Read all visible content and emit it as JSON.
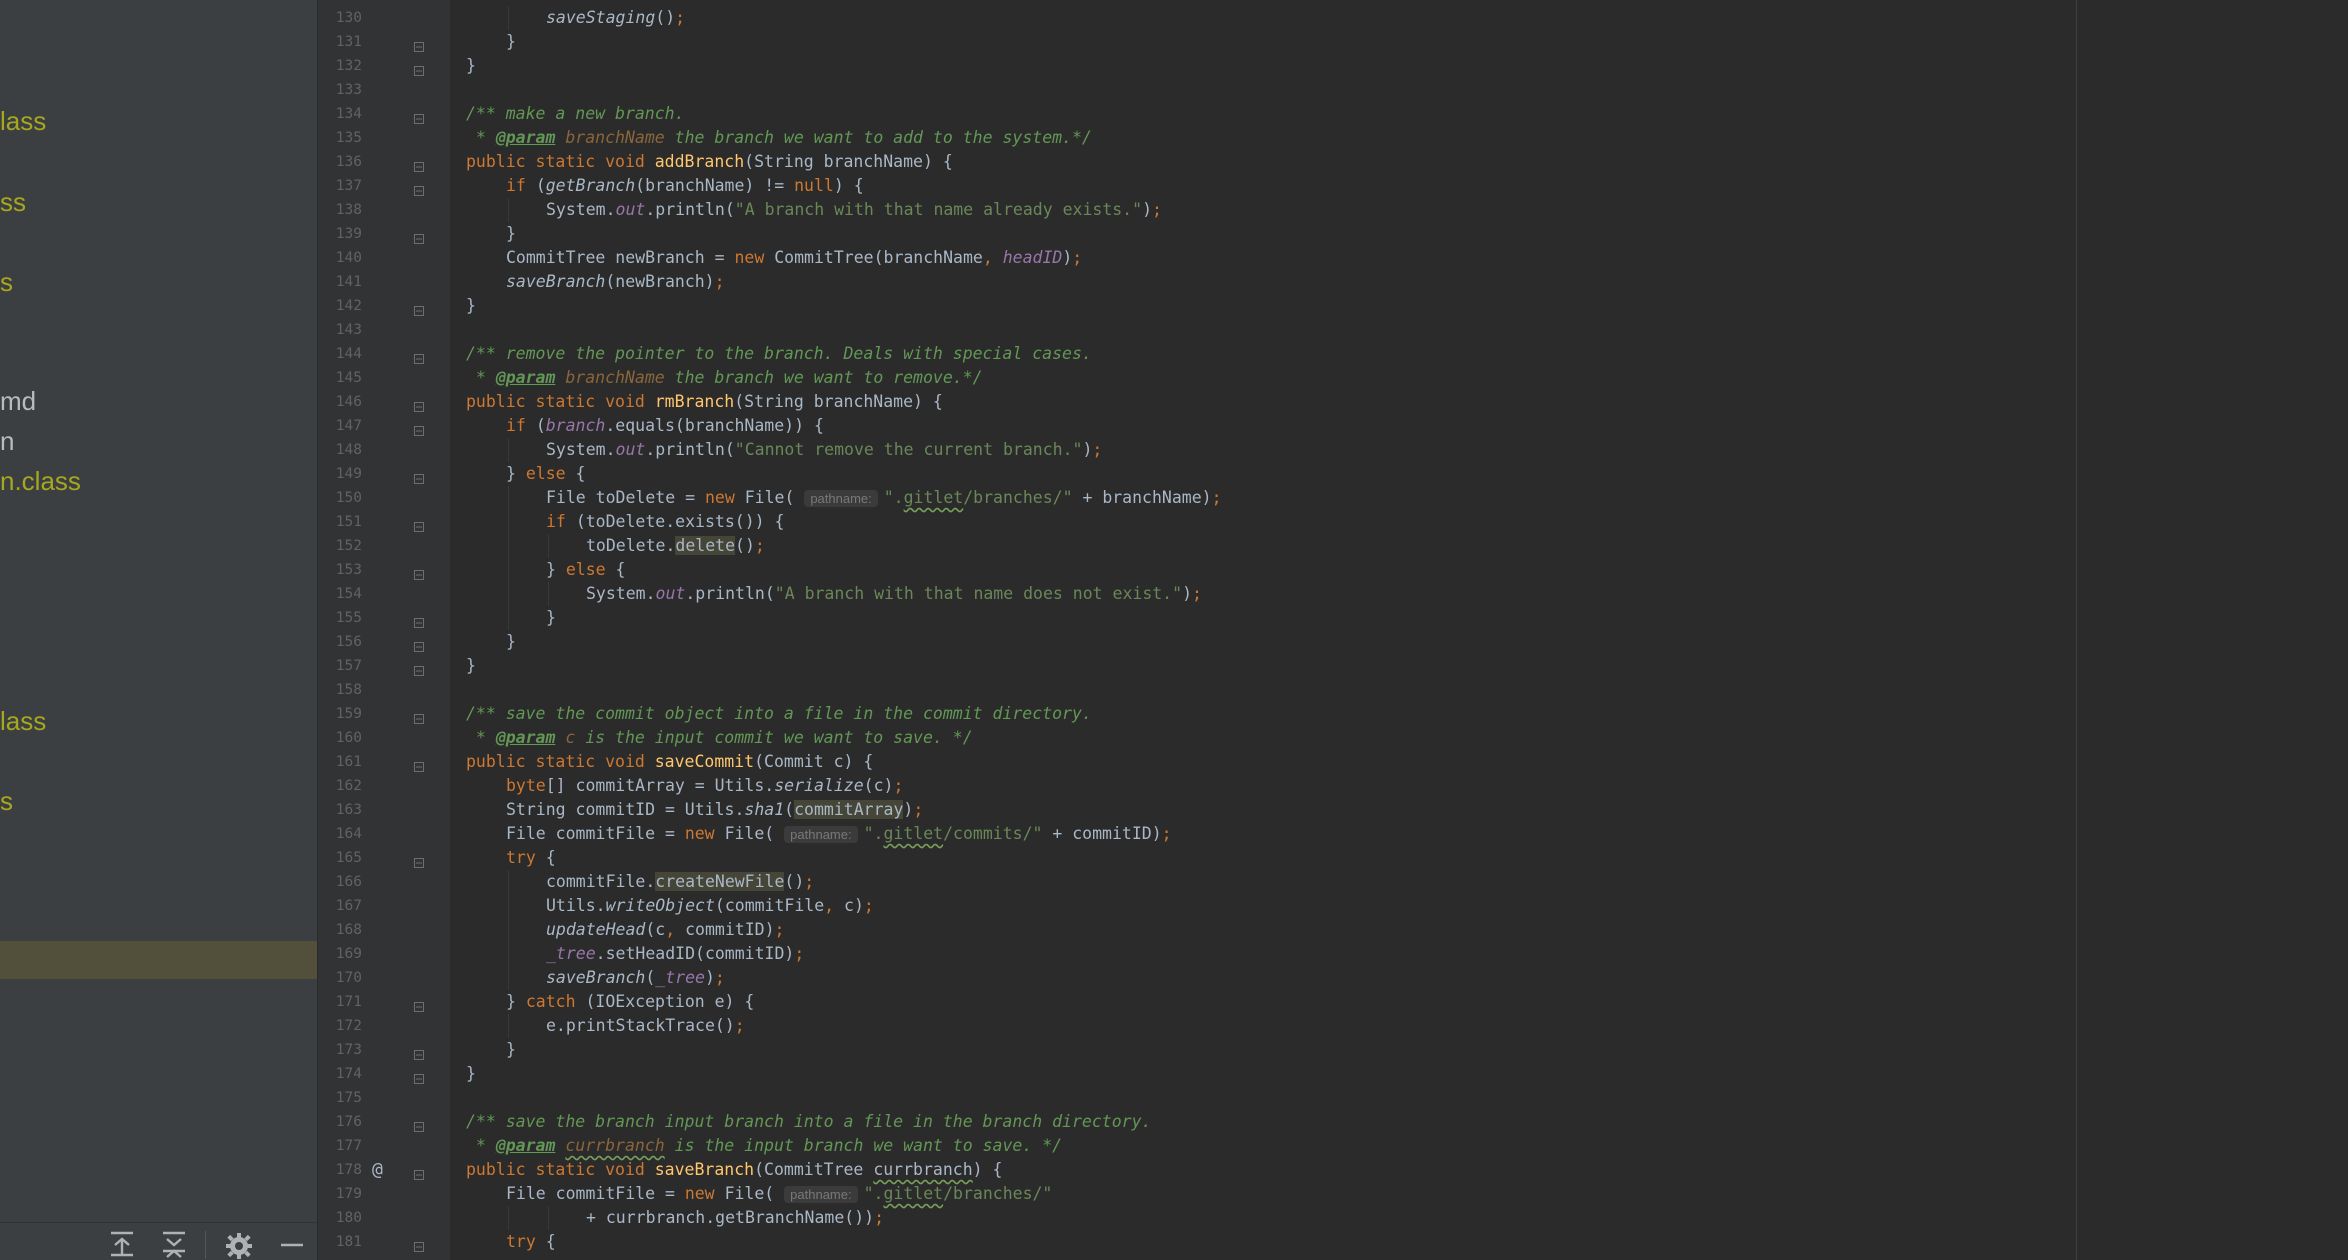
{
  "sidebar": {
    "items": [
      {
        "label": "lass",
        "style": "ignored"
      },
      {
        "label": "ss",
        "style": "ignored"
      },
      {
        "label": "s",
        "style": "ignored"
      },
      {
        "label": "md",
        "style": "plain"
      },
      {
        "label": "n",
        "style": "plain"
      },
      {
        "label": "n.class",
        "style": "ignored"
      },
      {
        "label": "lass",
        "style": "ignored"
      },
      {
        "label": "s",
        "style": "ignored"
      }
    ]
  },
  "editor": {
    "lines": [
      {
        "n": "130",
        "indent": 2,
        "html": "<span class=\"st\">saveStaging</span>()<span class=\"kw\">;</span>"
      },
      {
        "n": "131",
        "indent": 1,
        "html": "}"
      },
      {
        "n": "132",
        "indent": 0,
        "html": "}"
      },
      {
        "n": "133",
        "indent": 0,
        "html": ""
      },
      {
        "n": "134",
        "indent": 0,
        "html": "<span class=\"cm\">/** make a new branch.</span>"
      },
      {
        "n": "135",
        "indent": 0,
        "html": "<span class=\"cm\"> * </span><span class=\"tag\">@param</span><span class=\"cm\"> </span><span class=\"pn\">branchName</span><span class=\"cm\"> the branch we want to add to the system.*/</span>"
      },
      {
        "n": "136",
        "indent": 0,
        "html": "<span class=\"kw\">public static void </span><span class=\"fn\">addBranch</span>(String branchName) {"
      },
      {
        "n": "137",
        "indent": 1,
        "html": "<span class=\"kw\">if </span>(<span class=\"st\">getBranch</span>(branchName) != <span class=\"kw\">null</span>) {"
      },
      {
        "n": "138",
        "indent": 2,
        "html": "System.<span class=\"fld\">out</span>.println(<span class=\"str\">\"A branch with that name already exists.\"</span>)<span class=\"kw\">;</span>"
      },
      {
        "n": "139",
        "indent": 1,
        "html": "}"
      },
      {
        "n": "140",
        "indent": 1,
        "html": "CommitTree newBranch = <span class=\"kw\">new </span>CommitTree(branchName<span class=\"kw\">, </span><span class=\"fld\">headID</span>)<span class=\"kw\">;</span>"
      },
      {
        "n": "141",
        "indent": 1,
        "html": "<span class=\"st\">saveBranch</span>(newBranch)<span class=\"kw\">;</span>"
      },
      {
        "n": "142",
        "indent": 0,
        "html": "}"
      },
      {
        "n": "143",
        "indent": 0,
        "html": ""
      },
      {
        "n": "144",
        "indent": 0,
        "html": "<span class=\"cm\">/** remove the pointer to the branch. Deals with special cases.</span>"
      },
      {
        "n": "145",
        "indent": 0,
        "html": "<span class=\"cm\"> * </span><span class=\"tag\">@param</span><span class=\"cm\"> </span><span class=\"pn\">branchName</span><span class=\"cm\"> the branch we want to remove.*/</span>"
      },
      {
        "n": "146",
        "indent": 0,
        "html": "<span class=\"kw\">public static void </span><span class=\"fn\">rmBranch</span>(String branchName) {"
      },
      {
        "n": "147",
        "indent": 1,
        "html": "<span class=\"kw\">if </span>(<span class=\"fld\">branch</span>.equals(branchName)) {"
      },
      {
        "n": "148",
        "indent": 2,
        "html": "System.<span class=\"fld\">out</span>.println(<span class=\"str\">\"Cannot remove the current branch.\"</span>)<span class=\"kw\">;</span>"
      },
      {
        "n": "149",
        "indent": 1,
        "html": "} <span class=\"kw\">else </span>{"
      },
      {
        "n": "150",
        "indent": 2,
        "html": "File toDelete = <span class=\"kw\">new </span>File( <span class=\"hint\">pathname:</span><span class=\"str\">\".<span class=\"sq\">gitlet</span>/branches/\"</span> + branchName)<span class=\"kw\">;</span>"
      },
      {
        "n": "151",
        "indent": 2,
        "html": "<span class=\"kw\">if </span>(toDelete.exists()) {"
      },
      {
        "n": "152",
        "indent": 3,
        "html": "toDelete.<span class=\"hl\">delete</span>()<span class=\"kw\">;</span>"
      },
      {
        "n": "153",
        "indent": 2,
        "html": "} <span class=\"kw\">else </span>{"
      },
      {
        "n": "154",
        "indent": 3,
        "html": "System.<span class=\"fld\">out</span>.println(<span class=\"str\">\"A branch with that name does not exist.\"</span>)<span class=\"kw\">;</span>"
      },
      {
        "n": "155",
        "indent": 2,
        "html": "}"
      },
      {
        "n": "156",
        "indent": 1,
        "html": "}"
      },
      {
        "n": "157",
        "indent": 0,
        "html": "}"
      },
      {
        "n": "158",
        "indent": 0,
        "html": ""
      },
      {
        "n": "159",
        "indent": 0,
        "html": "<span class=\"cm\">/** save the commit object into a file in the commit directory.</span>"
      },
      {
        "n": "160",
        "indent": 0,
        "html": "<span class=\"cm\"> * </span><span class=\"tag\">@param</span><span class=\"cm\"> </span><span class=\"pn\">c</span><span class=\"cm\"> is the input commit we want to save. */</span>"
      },
      {
        "n": "161",
        "indent": 0,
        "html": "<span class=\"kw\">public static void </span><span class=\"fn\">saveCommit</span>(Commit c) {"
      },
      {
        "n": "162",
        "indent": 1,
        "html": "<span class=\"kw\">byte</span>[] commitArray = Utils.<span class=\"st\">serialize</span>(c)<span class=\"kw\">;</span>"
      },
      {
        "n": "163",
        "indent": 1,
        "html": "String commitID = Utils.<span class=\"st\">sha1</span>(<span class=\"hl\">commitArray</span>)<span class=\"kw\">;</span>"
      },
      {
        "n": "164",
        "indent": 1,
        "html": "File commitFile = <span class=\"kw\">new </span>File( <span class=\"hint\">pathname:</span><span class=\"str\">\".<span class=\"sq\">gitlet</span>/commits/\"</span> + commitID)<span class=\"kw\">;</span>"
      },
      {
        "n": "165",
        "indent": 1,
        "html": "<span class=\"kw\">try </span>{"
      },
      {
        "n": "166",
        "indent": 2,
        "html": "commitFile.<span class=\"hl\">createNewFile</span>()<span class=\"kw\">;</span>"
      },
      {
        "n": "167",
        "indent": 2,
        "html": "Utils.<span class=\"st\">writeObject</span>(commitFile<span class=\"kw\">, </span>c)<span class=\"kw\">;</span>"
      },
      {
        "n": "168",
        "indent": 2,
        "html": "<span class=\"st\">updateHead</span>(c<span class=\"kw\">, </span>commitID)<span class=\"kw\">;</span>"
      },
      {
        "n": "169",
        "indent": 2,
        "html": "<span class=\"fld\">_tree</span>.setHeadID(commitID)<span class=\"kw\">;</span>"
      },
      {
        "n": "170",
        "indent": 2,
        "html": "<span class=\"st\">saveBranch</span>(<span class=\"fld\">_tree</span>)<span class=\"kw\">;</span>"
      },
      {
        "n": "171",
        "indent": 1,
        "html": "} <span class=\"kw\">catch </span>(IOException e) {"
      },
      {
        "n": "172",
        "indent": 2,
        "html": "e.printStackTrace()<span class=\"kw\">;</span>"
      },
      {
        "n": "173",
        "indent": 1,
        "html": "}"
      },
      {
        "n": "174",
        "indent": 0,
        "html": "}"
      },
      {
        "n": "175",
        "indent": 0,
        "html": ""
      },
      {
        "n": "176",
        "indent": 0,
        "html": "<span class=\"cm\">/** save the branch input branch into a file in the branch directory.</span>"
      },
      {
        "n": "177",
        "indent": 0,
        "html": "<span class=\"cm\"> * </span><span class=\"tag\">@param</span><span class=\"cm\"> </span><span class=\"pn sq\">currbranch</span><span class=\"cm\"> is the input branch we want to save. */</span>"
      },
      {
        "n": "178",
        "indent": 0,
        "html": "<span class=\"kw\">public static void </span><span class=\"fn\">saveBranch</span>(CommitTree <span class=\"sq\">currbranch</span>) {"
      },
      {
        "n": "179",
        "indent": 1,
        "html": "File commitFile = <span class=\"kw\">new </span>File( <span class=\"hint\">pathname:</span><span class=\"str\">\".<span class=\"sq\">gitlet</span>/branches/\"</span>"
      },
      {
        "n": "180",
        "indent": 3,
        "html": "+ currbranch.getBranchName())<span class=\"kw\">;</span>"
      },
      {
        "n": "181",
        "indent": 1,
        "html": "<span class=\"kw\">try </span>{"
      }
    ],
    "gutter_marker_line": "178",
    "gutter_marker": "@"
  },
  "colors": {
    "sidebar_bg": "#3c3f41",
    "editor_bg": "#2b2b2b",
    "gutter_bg": "#313335",
    "keyword": "#cc7832",
    "comment": "#629755",
    "string": "#6a8759",
    "method": "#ffc66d",
    "field": "#9876aa",
    "ignored_file": "#a6a71e"
  }
}
